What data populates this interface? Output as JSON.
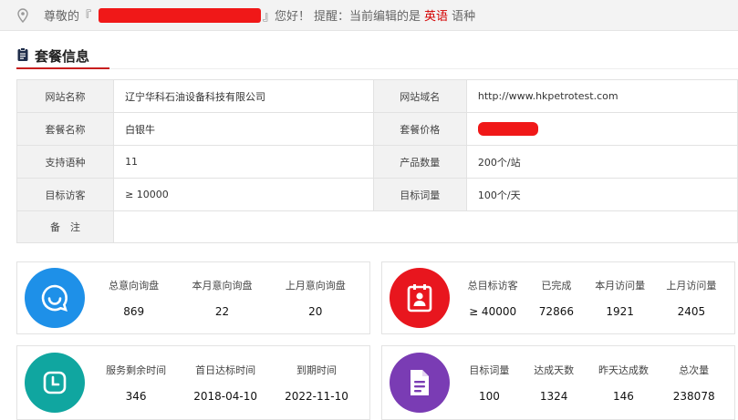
{
  "notice": {
    "greeting": "尊敬的『",
    "greeting_suffix": "』您好！",
    "reminder_label": "提醒：当前编辑的是",
    "language": "英语",
    "language_suffix": "语种"
  },
  "section": {
    "title": "套餐信息"
  },
  "info_table": {
    "rows": [
      {
        "l1": "网站名称",
        "v1": "辽宁华科石油设备科技有限公司",
        "l2": "网站域名",
        "v2": "http://www.hkpetrotest.com"
      },
      {
        "l1": "套餐名称",
        "v1": "白银牛",
        "l2": "套餐价格",
        "v2": ""
      },
      {
        "l1": "支持语种",
        "v1": "11",
        "l2": "产品数量",
        "v2": "200个/站"
      },
      {
        "l1": "目标访客",
        "v1": "≥ 10000",
        "l2": "目标词量",
        "v2": "100个/天"
      },
      {
        "l1": "备　注",
        "v1": ""
      }
    ]
  },
  "cards": {
    "inquiry": {
      "icon": "chat-bubble-icon",
      "color": "#1e90e8",
      "stats": [
        {
          "label": "总意向询盘",
          "value": "869"
        },
        {
          "label": "本月意向询盘",
          "value": "22"
        },
        {
          "label": "上月意向询盘",
          "value": "20"
        }
      ]
    },
    "visitors": {
      "icon": "calendar-user-icon",
      "color": "#e8161e",
      "stats": [
        {
          "label": "总目标访客",
          "value": "≥ 40000"
        },
        {
          "label": "已完成",
          "value": "72866"
        },
        {
          "label": "本月访问量",
          "value": "1921"
        },
        {
          "label": "上月访问量",
          "value": "2405"
        }
      ]
    },
    "service": {
      "icon": "clock-icon",
      "color": "#10a6a0",
      "stats": [
        {
          "label": "服务剩余时间",
          "value": "346"
        },
        {
          "label": "首日达标时间",
          "value": "2018-04-10"
        },
        {
          "label": "到期时间",
          "value": "2022-11-10"
        }
      ]
    },
    "keywords": {
      "icon": "document-icon",
      "color": "#7a3cb4",
      "stats": [
        {
          "label": "目标词量",
          "value": "100"
        },
        {
          "label": "达成天数",
          "value": "1324"
        },
        {
          "label": "昨天达成数",
          "value": "146"
        },
        {
          "label": "总次量",
          "value": "238078"
        }
      ]
    }
  }
}
